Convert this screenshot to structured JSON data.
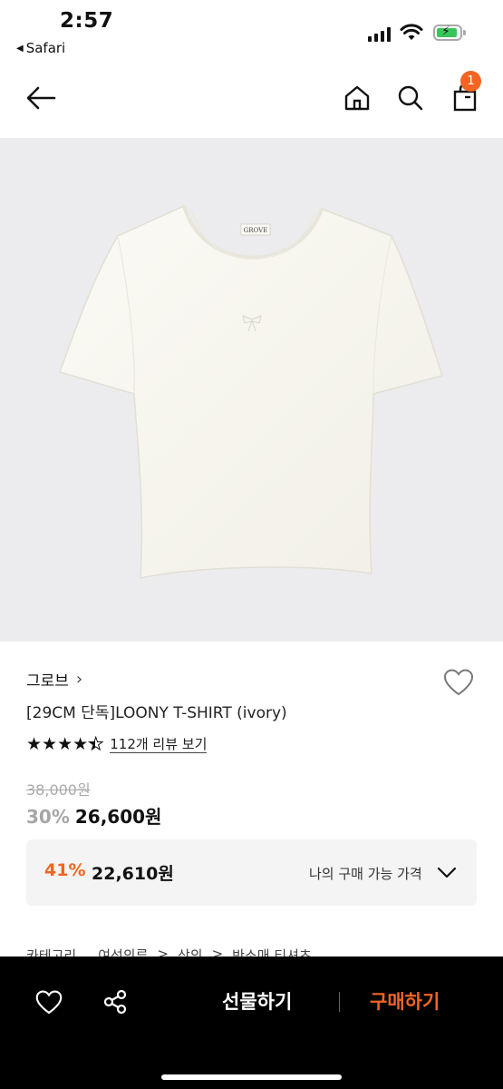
{
  "status_bar": {
    "time": "2:57",
    "back_app": "Safari",
    "back_arrow_icon": "triangle-left-icon",
    "battery_color": "#3ac55b"
  },
  "header": {
    "back_icon": "arrow-left-icon",
    "home_icon": "home-icon",
    "search_icon": "search-icon",
    "cart_icon": "shopping-bag-icon",
    "cart_count": "1",
    "accent_color": "#f26522"
  },
  "product": {
    "image_label": "GROVE",
    "brand": "그로브",
    "brand_arrow": "›",
    "title": "[29CM 단독]LOONY T-SHIRT (ivory)",
    "rating": 4.5,
    "review_link": "112개 리뷰 보기",
    "original_price": "38,000원",
    "discount_rate": "30%",
    "price": "26,600원"
  },
  "benefit": {
    "rate": "41%",
    "price": "22,610원",
    "label": "나의 구매 가능 가격"
  },
  "breadcrumb": {
    "items": [
      "카테고리",
      "여성의류",
      "상의",
      "반소매 티셔츠"
    ],
    "separator": ">"
  },
  "bottom_bar": {
    "wishlist_icon": "heart-icon",
    "share_icon": "share-icon",
    "gift_label": "선물하기",
    "buy_label": "구매하기"
  }
}
